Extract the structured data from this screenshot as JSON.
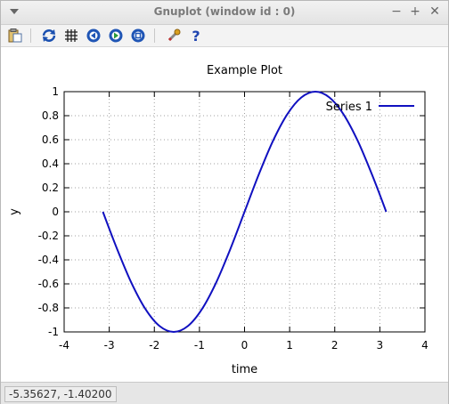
{
  "window": {
    "title": "Gnuplot (window id : 0)",
    "controls": [
      "−",
      "+",
      "✕"
    ]
  },
  "toolbar": {
    "tools": [
      {
        "icon": "copy-to-clipboard-icon"
      },
      {
        "icon": "replot-icon"
      },
      {
        "icon": "grid-icon"
      },
      {
        "icon": "zoom-previous-icon"
      },
      {
        "icon": "zoom-next-icon"
      },
      {
        "icon": "autoscale-icon"
      },
      {
        "icon": "settings-wrench-icon"
      },
      {
        "icon": "help-icon"
      }
    ]
  },
  "status": {
    "coordinates": "-5.35627, -1.40200"
  },
  "chart_data": {
    "type": "line",
    "title": "Example Plot",
    "xlabel": "time",
    "ylabel": "y",
    "xlim": [
      -4,
      4
    ],
    "ylim": [
      -1,
      1
    ],
    "xticks": [
      "-4",
      "-3",
      "-2",
      "-1",
      "0",
      "1",
      "2",
      "3",
      "4"
    ],
    "yticks": [
      "-1",
      "-0.8",
      "-0.6",
      "-0.4",
      "-0.2",
      "0",
      "0.2",
      "0.4",
      "0.6",
      "0.8",
      "1"
    ],
    "grid": true,
    "legend_position": "top-right",
    "series": [
      {
        "name": "Series 1",
        "color": "#1010c0",
        "x": [
          -3.1416,
          -2.8274,
          -2.5133,
          -2.1991,
          -1.885,
          -1.5708,
          -1.2566,
          -0.9425,
          -0.6283,
          -0.3142,
          0.0,
          0.3142,
          0.6283,
          0.9425,
          1.2566,
          1.5708,
          1.885,
          2.1991,
          2.5133,
          2.8274,
          3.1416
        ],
        "y": [
          0.0,
          -0.309,
          -0.5878,
          -0.809,
          -0.9511,
          -1.0,
          -0.9511,
          -0.809,
          -0.5878,
          -0.309,
          0.0,
          0.309,
          0.5878,
          0.809,
          0.9511,
          1.0,
          0.9511,
          0.809,
          0.5878,
          0.309,
          0.0
        ]
      }
    ]
  }
}
